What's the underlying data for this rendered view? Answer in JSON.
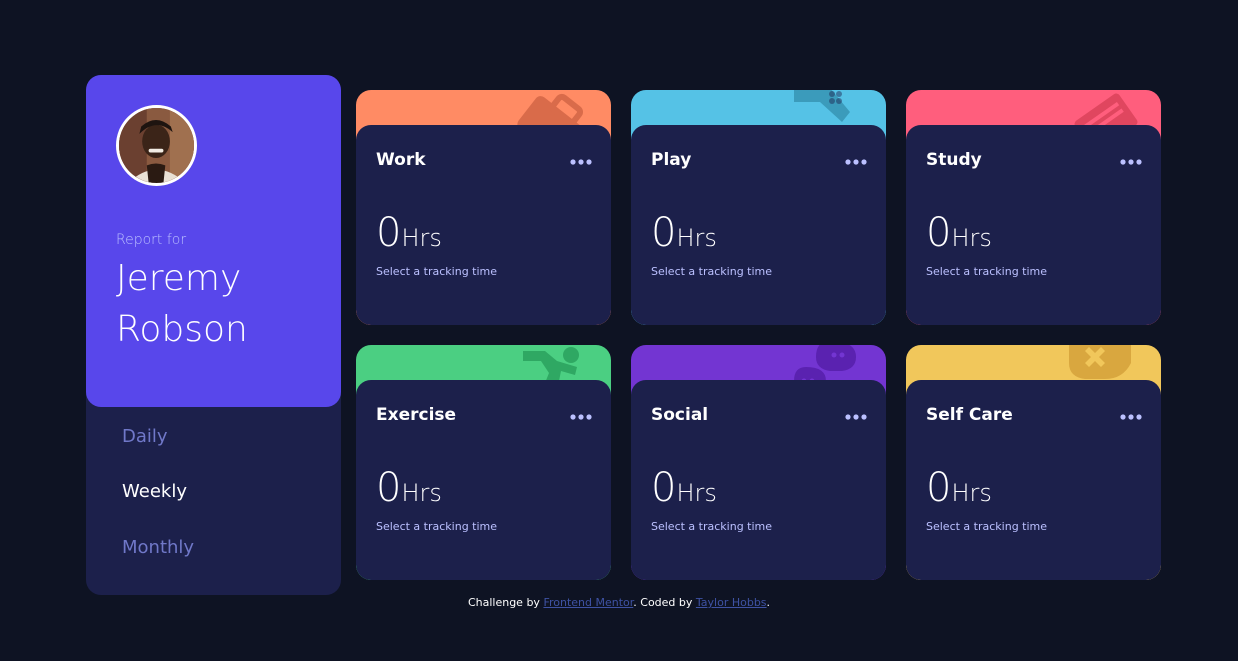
{
  "profile": {
    "report_for": "Report for",
    "first_name": "Jeremy",
    "last_name": "Robson",
    "accent_color": "#5847eb",
    "panel_color": "#1c204b"
  },
  "periods": [
    {
      "label": "Daily",
      "active": false
    },
    {
      "label": "Weekly",
      "active": true
    },
    {
      "label": "Monthly",
      "active": false
    }
  ],
  "cards": [
    {
      "title": "Work",
      "hours_value": "0",
      "hours_unit": "Hrs",
      "hint": "Select a tracking time",
      "color": "#ff8b64",
      "icon": "briefcase-icon"
    },
    {
      "title": "Play",
      "hours_value": "0",
      "hours_unit": "Hrs",
      "hint": "Select a tracking time",
      "color": "#55c2e6",
      "icon": "gamepad-icon"
    },
    {
      "title": "Study",
      "hours_value": "0",
      "hours_unit": "Hrs",
      "hint": "Select a tracking time",
      "color": "#ff5e7d",
      "icon": "book-icon"
    },
    {
      "title": "Exercise",
      "hours_value": "0",
      "hours_unit": "Hrs",
      "hint": "Select a tracking time",
      "color": "#4bcf82",
      "icon": "runner-icon"
    },
    {
      "title": "Social",
      "hours_value": "0",
      "hours_unit": "Hrs",
      "hint": "Select a tracking time",
      "color": "#7335d2",
      "icon": "chat-icon"
    },
    {
      "title": "Self Care",
      "hours_value": "0",
      "hours_unit": "Hrs",
      "hint": "Select a tracking time",
      "color": "#f1c75b",
      "icon": "heart-icon"
    }
  ],
  "footer": {
    "prefix": "Challenge by ",
    "challenge_link": "Frontend Mentor",
    "middle": ". Coded by ",
    "author_link": "Taylor Hobbs",
    "suffix": "."
  }
}
